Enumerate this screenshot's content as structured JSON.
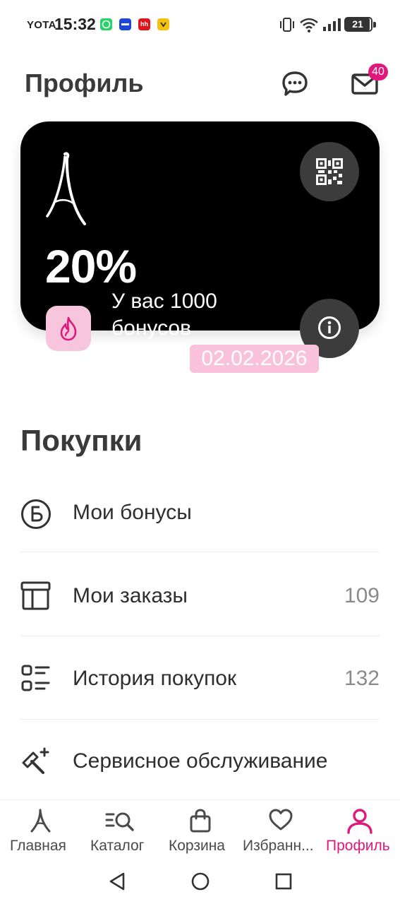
{
  "status_bar": {
    "carrier": "YOTA",
    "time": "15:32",
    "battery": "21",
    "apps": [
      {
        "name": "whatsapp",
        "color": "#25d366"
      },
      {
        "name": "app-blue",
        "color": "#1a47d8"
      },
      {
        "name": "hh",
        "color": "#e0141e",
        "label": "hh"
      },
      {
        "name": "app-yellow",
        "color": "#f4c20d"
      }
    ]
  },
  "header": {
    "title": "Профиль",
    "chat_icon": "chat-icon",
    "mail_icon": "mail-icon",
    "mail_badge": "40"
  },
  "card": {
    "discount": "20%",
    "bonus_line1": "У вас 1000",
    "bonus_line2": "бонусов",
    "date": "02.02.2026",
    "background": "#000000",
    "icons": [
      "eiffel-logo-icon",
      "qr-code-icon",
      "fire-icon",
      "info-icon"
    ]
  },
  "purchases": {
    "title": "Покупки",
    "items": [
      {
        "label": "Мои бонусы",
        "count": "",
        "icon": "bonus-icon"
      },
      {
        "label": "Мои заказы",
        "count": "109",
        "icon": "box-icon"
      },
      {
        "label": "История покупок",
        "count": "132",
        "icon": "history-list-icon"
      },
      {
        "label": "Сервисное обслуживание",
        "count": "",
        "icon": "service-tools-icon"
      }
    ]
  },
  "bottom_nav": {
    "active": "Профиль",
    "accent": "#e0187c",
    "items": [
      {
        "label": "Главная",
        "icon": "home-logo-icon"
      },
      {
        "label": "Каталог",
        "icon": "catalog-search-icon"
      },
      {
        "label": "Корзина",
        "icon": "bag-icon"
      },
      {
        "label": "Избранн...",
        "icon": "heart-icon"
      },
      {
        "label": "Профиль",
        "icon": "user-icon"
      }
    ]
  },
  "system_nav": [
    "back-icon",
    "home-icon",
    "recents-icon"
  ]
}
